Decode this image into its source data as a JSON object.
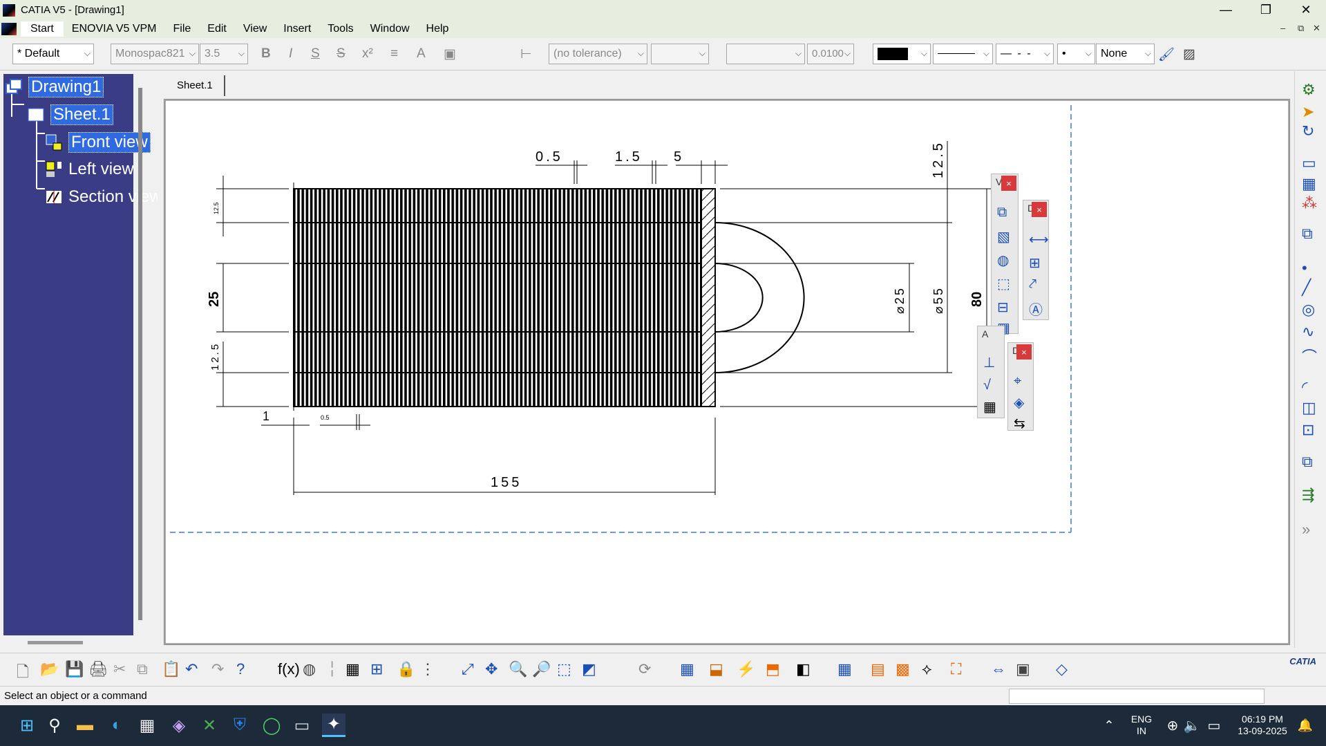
{
  "window": {
    "title": "CATIA V5 - [Drawing1]",
    "minimize": "—",
    "maximize": "❐",
    "close": "✕"
  },
  "menu": {
    "items": [
      "Start",
      "ENOVIA V5 VPM",
      "File",
      "Edit",
      "View",
      "Insert",
      "Tools",
      "Window",
      "Help"
    ],
    "mdi": {
      "minimize": "–",
      "restore": "⧉",
      "close": "✕"
    }
  },
  "toolbar": {
    "style": "Default",
    "font": "Monospac821",
    "font_size": "3.5",
    "tolerance": "(no tolerance)",
    "precision": "0.0100",
    "line_type": "None"
  },
  "tree": {
    "root": "Drawing1",
    "sheet": "Sheet.1",
    "views": [
      "Front view",
      "Left view",
      "Section view"
    ]
  },
  "sheet_tab": "Sheet.1",
  "drawing": {
    "dims": {
      "d_top_05": "0.5",
      "d_top_15": "1.5",
      "d_top_5": "5",
      "d_right_125": "12.5",
      "d_left_125a": "12.5",
      "d_left_25": "25",
      "d_left_125b": "12.5",
      "d_bottom_1": "1",
      "d_bottom_05": "0.5",
      "d_bottom_155": "155",
      "d_dia25": "⌀25",
      "d_dia55": "⌀55",
      "d_80": "80"
    }
  },
  "floating_toolbars": {
    "views_title": "V",
    "dims_title": "D",
    "annot_title": "A",
    "geom_title": "D",
    "close": "×"
  },
  "status": {
    "text": "Select an object or a command"
  },
  "brand": "CATIA",
  "taskbar": {
    "lang": "ENG",
    "region": "IN",
    "time": "06:19 PM",
    "date": "13-09-2025"
  }
}
